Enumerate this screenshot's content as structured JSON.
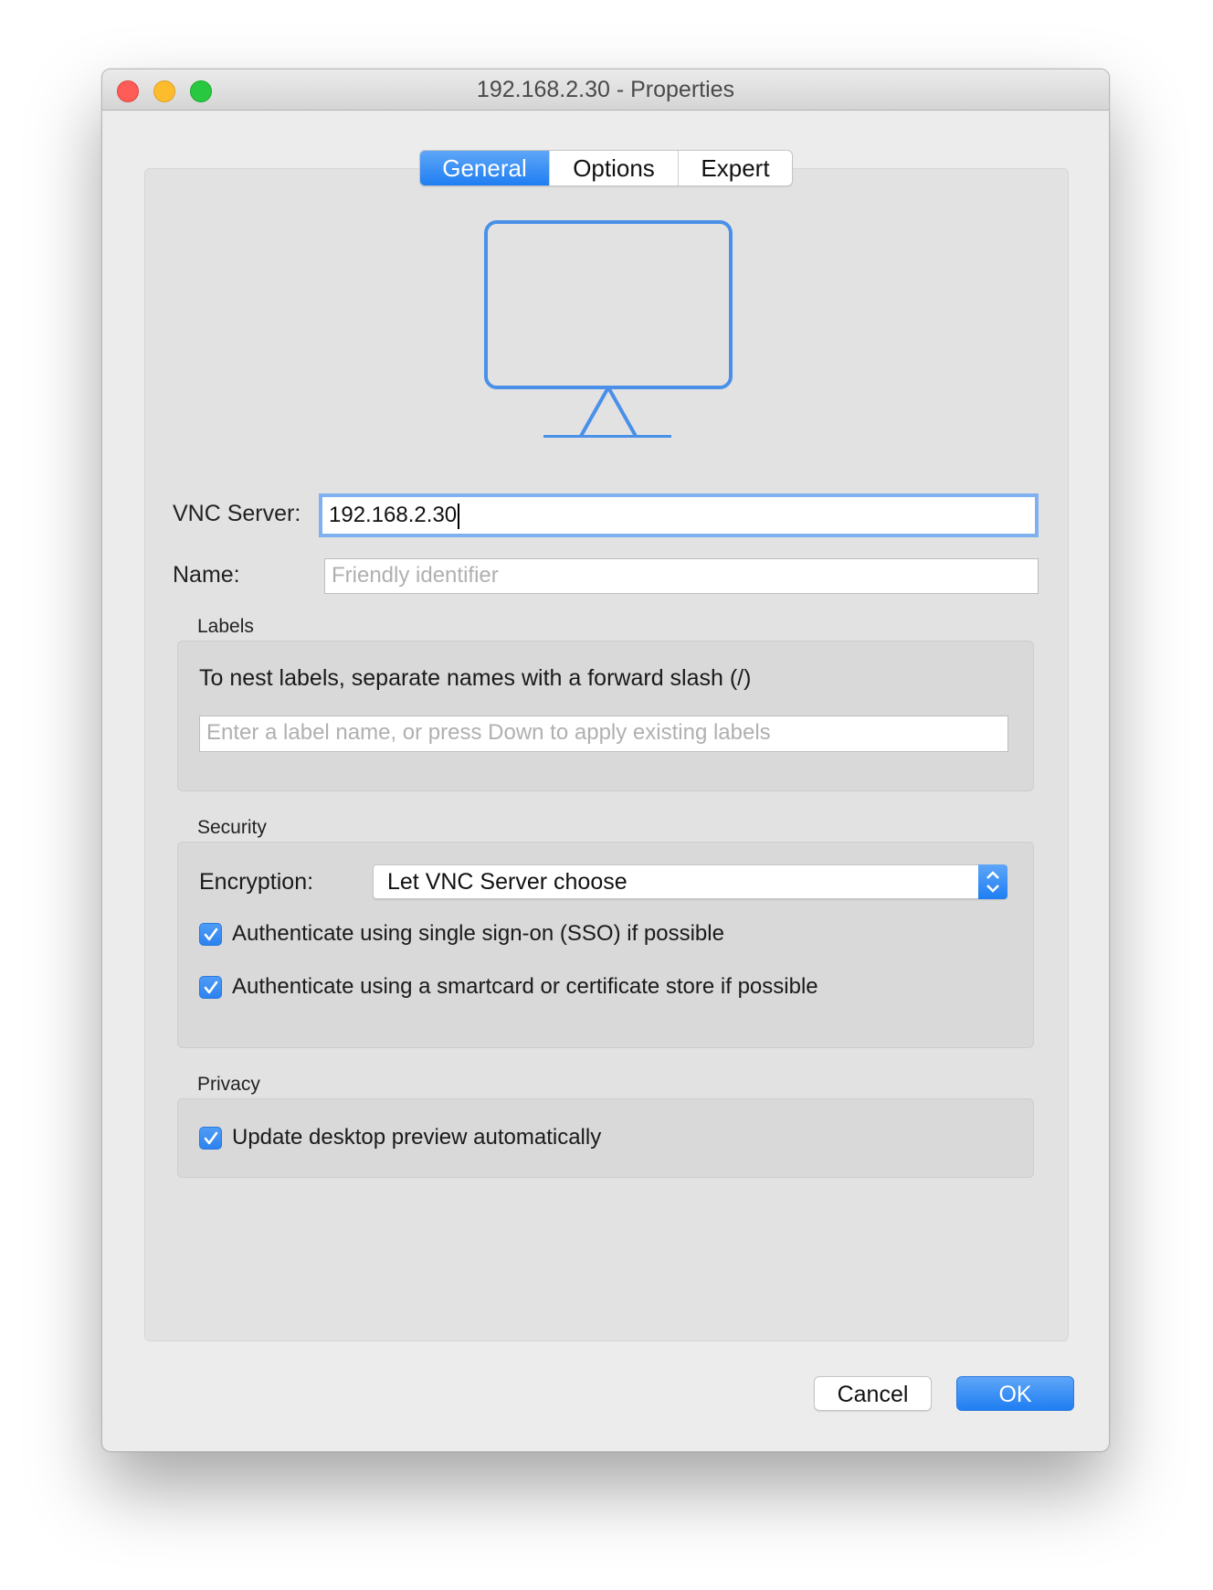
{
  "window": {
    "title": "192.168.2.30 - Properties"
  },
  "tabs": [
    {
      "label": "General",
      "active": true
    },
    {
      "label": "Options",
      "active": false
    },
    {
      "label": "Expert",
      "active": false
    }
  ],
  "icon": "monitor-icon",
  "form": {
    "vnc_server_label": "VNC Server:",
    "vnc_server_value": "192.168.2.30",
    "name_label": "Name:",
    "name_placeholder": "Friendly identifier"
  },
  "labels_section": {
    "title": "Labels",
    "hint": "To nest labels, separate names with a forward slash (/)",
    "input_placeholder": "Enter a label name, or press Down to apply existing labels"
  },
  "security_section": {
    "title": "Security",
    "encryption_label": "Encryption:",
    "encryption_value": "Let VNC Server choose",
    "sso_label": "Authenticate using single sign-on (SSO) if possible",
    "sso_checked": true,
    "smartcard_label": "Authenticate using a smartcard or certificate store if possible",
    "smartcard_checked": true
  },
  "privacy_section": {
    "title": "Privacy",
    "preview_label": "Update desktop preview automatically",
    "preview_checked": true
  },
  "buttons": {
    "cancel": "Cancel",
    "ok": "OK"
  },
  "colors": {
    "accent": "#2d82ee",
    "close": "#fd5d56",
    "minimize": "#fdbc2e",
    "maximize": "#28c940"
  }
}
